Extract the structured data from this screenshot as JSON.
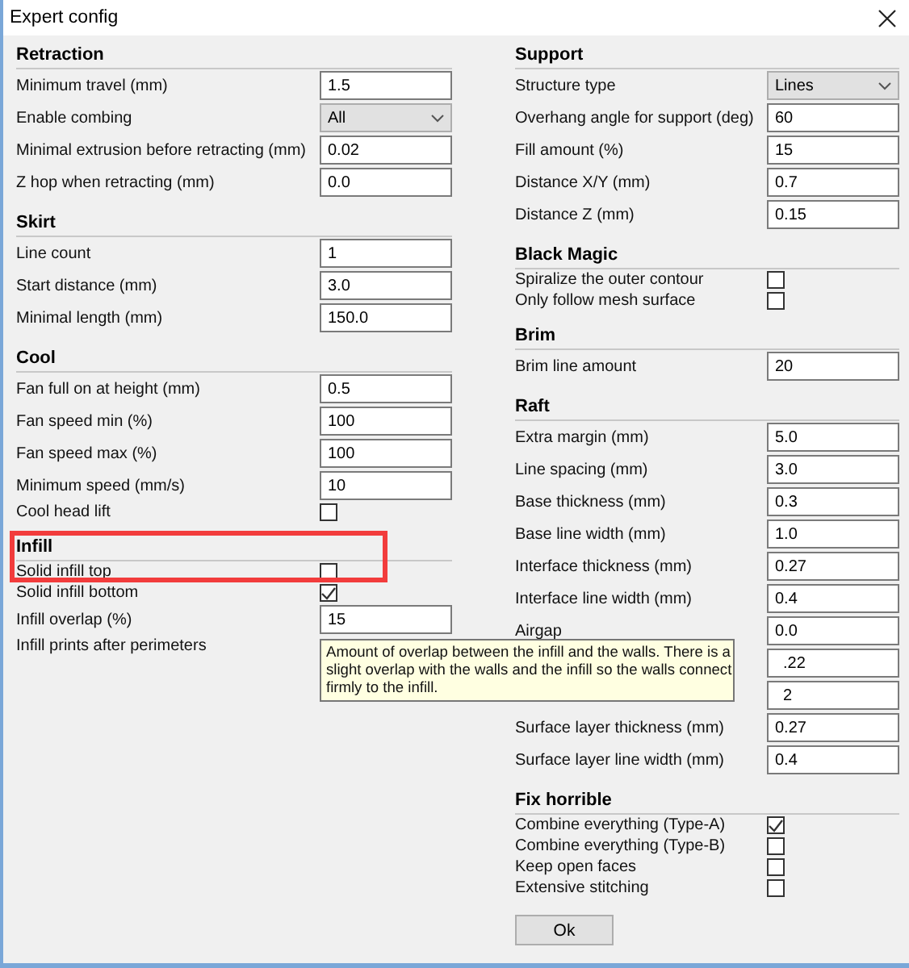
{
  "window": {
    "title": "Expert config"
  },
  "columns": [
    {
      "sections": [
        {
          "title": "Retraction",
          "rows": [
            {
              "kind": "input",
              "label": "Minimum travel (mm)",
              "value": "1.5"
            },
            {
              "kind": "select",
              "label": "Enable combing",
              "value": "All"
            },
            {
              "kind": "input",
              "label": "Minimal extrusion before retracting (mm)",
              "value": "0.02"
            },
            {
              "kind": "input",
              "label": "Z hop when retracting (mm)",
              "value": "0.0"
            }
          ]
        },
        {
          "title": "Skirt",
          "rows": [
            {
              "kind": "input",
              "label": "Line count",
              "value": "1"
            },
            {
              "kind": "input",
              "label": "Start distance (mm)",
              "value": "3.0"
            },
            {
              "kind": "input",
              "label": "Minimal length (mm)",
              "value": "150.0"
            }
          ]
        },
        {
          "title": "Cool",
          "rows": [
            {
              "kind": "input",
              "label": "Fan full on at height (mm)",
              "value": "0.5"
            },
            {
              "kind": "input",
              "label": "Fan speed min (%)",
              "value": "100"
            },
            {
              "kind": "input",
              "label": "Fan speed max (%)",
              "value": "100"
            },
            {
              "kind": "input",
              "label": "Minimum speed (mm/s)",
              "value": "10"
            },
            {
              "kind": "checkbox",
              "label": "Cool head lift",
              "checked": false
            }
          ]
        },
        {
          "title": "Infill",
          "rows": [
            {
              "kind": "checkbox",
              "label": "Solid infill top",
              "checked": false
            },
            {
              "kind": "checkbox",
              "label": "Solid infill bottom",
              "checked": true
            },
            {
              "kind": "input",
              "label": "Infill overlap (%)",
              "value": "15"
            },
            {
              "kind": "text",
              "label": "Infill prints after perimeters"
            }
          ]
        }
      ]
    },
    {
      "sections": [
        {
          "title": "Support",
          "rows": [
            {
              "kind": "select",
              "label": "Structure type",
              "value": "Lines"
            },
            {
              "kind": "input",
              "label": "Overhang angle for support (deg)",
              "value": "60"
            },
            {
              "kind": "input",
              "label": "Fill amount (%)",
              "value": "15"
            },
            {
              "kind": "input",
              "label": "Distance X/Y (mm)",
              "value": "0.7"
            },
            {
              "kind": "input",
              "label": "Distance Z (mm)",
              "value": "0.15"
            }
          ]
        },
        {
          "title": "Black Magic",
          "rows": [
            {
              "kind": "checkbox",
              "label": "Spiralize the outer contour",
              "checked": false
            },
            {
              "kind": "checkbox",
              "label": "Only follow mesh surface",
              "checked": false
            }
          ]
        },
        {
          "title": "Brim",
          "rows": [
            {
              "kind": "input",
              "label": "Brim line amount",
              "value": "20"
            }
          ]
        },
        {
          "title": "Raft",
          "rows": [
            {
              "kind": "input",
              "label": "Extra margin (mm)",
              "value": "5.0"
            },
            {
              "kind": "input",
              "label": "Line spacing (mm)",
              "value": "3.0"
            },
            {
              "kind": "input",
              "label": "Base thickness (mm)",
              "value": "0.3"
            },
            {
              "kind": "input",
              "label": "Base line width (mm)",
              "value": "1.0"
            },
            {
              "kind": "input",
              "label": "Interface thickness (mm)",
              "value": "0.27"
            },
            {
              "kind": "input",
              "label": "Interface line width (mm)",
              "value": "0.4"
            },
            {
              "kind": "input",
              "label": "Airgap",
              "value": "0.0"
            },
            {
              "kind": "input",
              "value": ".22"
            },
            {
              "kind": "input",
              "value": "2"
            },
            {
              "kind": "input",
              "label": "Surface layer thickness (mm)",
              "value": "0.27"
            },
            {
              "kind": "input",
              "label": "Surface layer line width (mm)",
              "value": "0.4"
            }
          ]
        },
        {
          "title": "Fix horrible",
          "rows": [
            {
              "kind": "checkbox",
              "label": "Combine everything (Type-A)",
              "checked": true
            },
            {
              "kind": "checkbox",
              "label": "Combine everything (Type-B)",
              "checked": false
            },
            {
              "kind": "checkbox",
              "label": "Keep open faces",
              "checked": false
            },
            {
              "kind": "checkbox",
              "label": "Extensive stitching",
              "checked": false
            }
          ]
        }
      ],
      "button": "Ok"
    }
  ],
  "tooltip": {
    "lines": [
      "Amount of overlap between the infill and the walls. There is a",
      "slight overlap with the walls and the infill so the walls connect",
      "firmly to the infill."
    ]
  },
  "annotations": [
    {
      "kind": "frame"
    }
  ]
}
